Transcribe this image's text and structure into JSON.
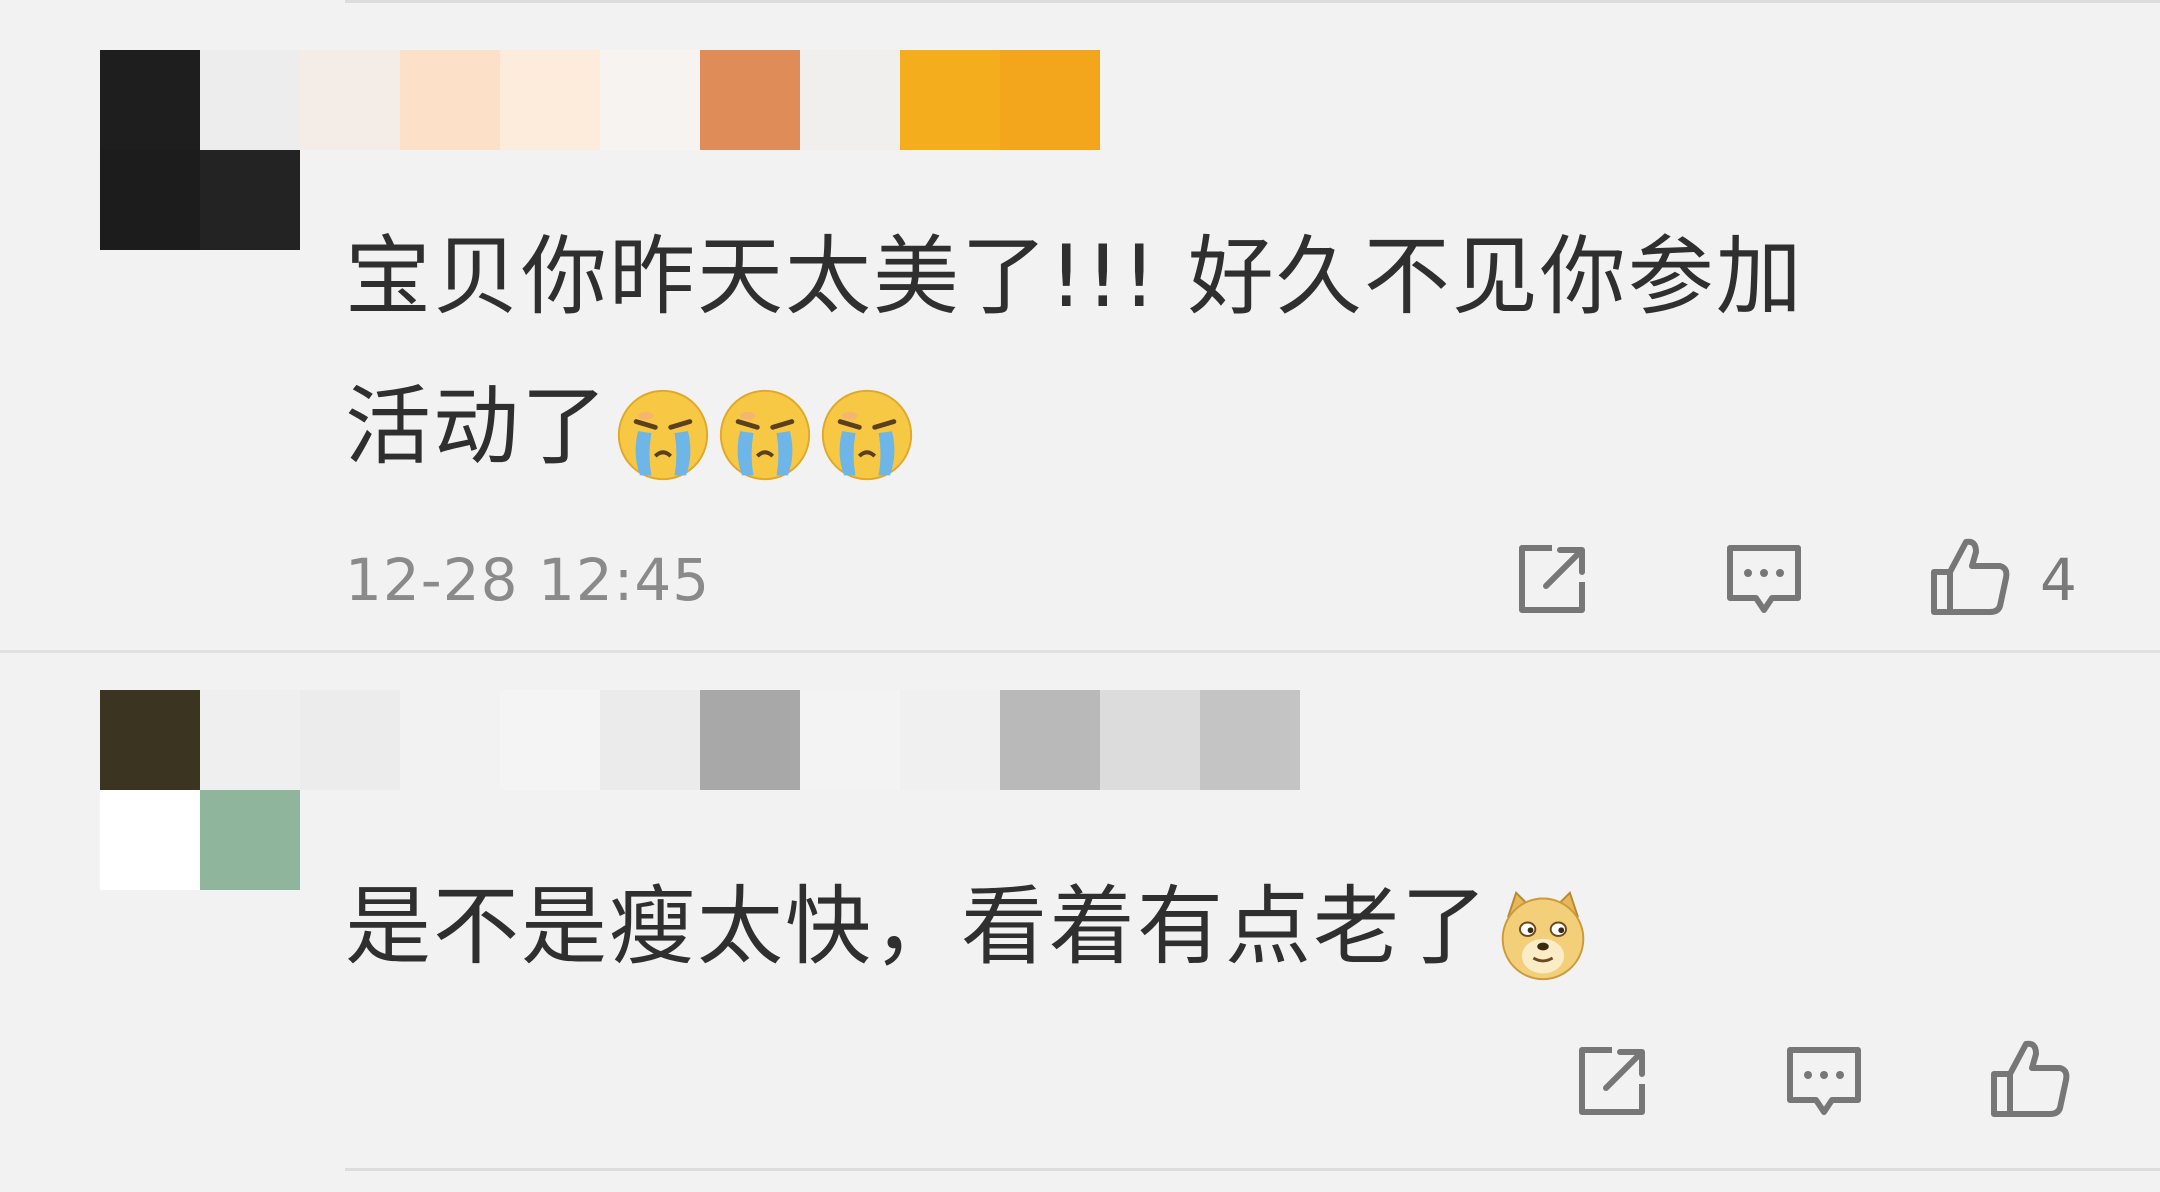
{
  "comments": [
    {
      "text_line1": "宝贝你昨天太美了!!! 好久不见你参加",
      "text_line2": "活动了",
      "emojis": [
        "crying-face-emoji",
        "crying-face-emoji",
        "crying-face-emoji"
      ],
      "timestamp": "12-28 12:45",
      "like_count": "4",
      "avatar_censored": true,
      "username_censored": true
    },
    {
      "text_line1": "是不是瘦太快，看着有点老了",
      "emojis": [
        "doge-emoji"
      ],
      "timestamp": "",
      "like_count": "",
      "avatar_censored": true,
      "username_censored": true
    }
  ],
  "icons": {
    "share": "share-icon",
    "reply": "comment-icon",
    "like": "thumbs-up-icon"
  },
  "colors": {
    "background": "#f2f2f2",
    "text": "#2f2f2f",
    "meta": "#8a8a8a",
    "emoji_yellow": "#f7c843",
    "emoji_tear": "#6fb6e8"
  }
}
